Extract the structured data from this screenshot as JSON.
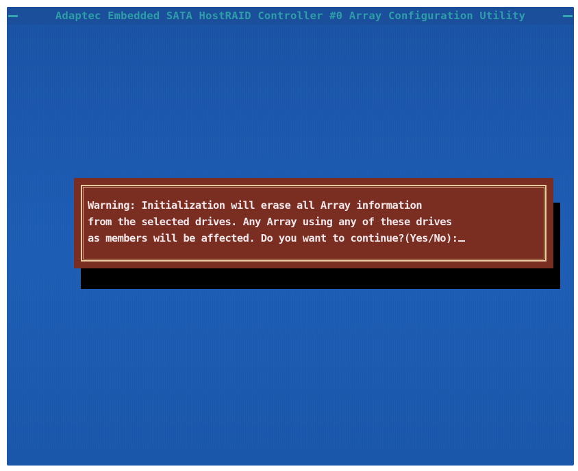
{
  "header": {
    "title": "Adaptec Embedded SATA HostRAID Controller #0 Array Configuration Utility"
  },
  "dialog": {
    "lines": [
      "Warning: Initialization will erase all Array information",
      "from the selected drives. Any Array using any of these drives",
      "as members will be affected. Do you want to continue?(Yes/No):"
    ],
    "input_value": ""
  },
  "colors": {
    "screen_background": "#1e5fb6",
    "title_text": "#2e9ea8",
    "dialog_background": "#7a2e22",
    "dialog_border": "#e8c9a0",
    "dialog_text": "#f2e7ea"
  }
}
